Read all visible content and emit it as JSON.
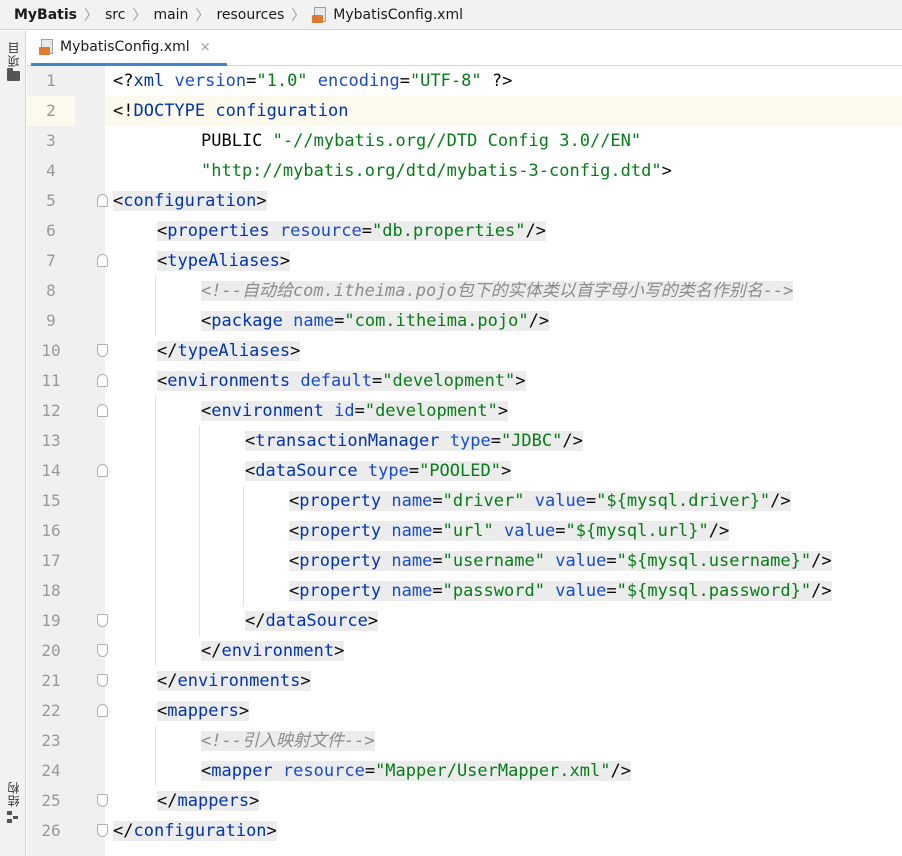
{
  "breadcrumb": {
    "project": "MyBatis",
    "items": [
      "src",
      "main",
      "resources",
      "MybatisConfig.xml"
    ]
  },
  "toolwindows": {
    "project_label": "项目",
    "structure_label": "结构"
  },
  "tab": {
    "label": "MybatisConfig.xml",
    "close": "×"
  },
  "editor": {
    "current_line": 2,
    "line_numbers": [
      "1",
      "2",
      "3",
      "4",
      "5",
      "6",
      "7",
      "8",
      "9",
      "10",
      "11",
      "12",
      "13",
      "14",
      "15",
      "16",
      "17",
      "18",
      "19",
      "20",
      "21",
      "22",
      "23",
      "24",
      "25",
      "26"
    ],
    "lines": [
      "<?xml version=\"1.0\" encoding=\"UTF-8\" ?>",
      "<!DOCTYPE configuration",
      "        PUBLIC \"-//mybatis.org//DTD Config 3.0//EN\"",
      "        \"http://mybatis.org/dtd/mybatis-3-config.dtd\">",
      "<configuration>",
      "    <properties resource=\"db.properties\"/>",
      "    <typeAliases>",
      "        <!--自动给com.itheima.pojo包下的实体类以首字母小写的类名作别名-->",
      "        <package name=\"com.itheima.pojo\"/>",
      "    </typeAliases>",
      "    <environments default=\"development\">",
      "        <environment id=\"development\">",
      "            <transactionManager type=\"JDBC\"/>",
      "            <dataSource type=\"POOLED\">",
      "                <property name=\"driver\" value=\"${mysql.driver}\"/>",
      "                <property name=\"url\" value=\"${mysql.url}\"/>",
      "                <property name=\"username\" value=\"${mysql.username}\"/>",
      "                <property name=\"password\" value=\"${mysql.password}\"/>",
      "            </dataSource>",
      "        </environment>",
      "    </environments>",
      "    <mappers>",
      "        <!--引入映射文件-->",
      "        <mapper resource=\"Mapper/UserMapper.xml\"/>",
      "    </mappers>",
      "</configuration>"
    ]
  },
  "colors": {
    "tag": "#0033b3",
    "attribute": "#174ad4",
    "value": "#067d17",
    "comment": "#8c8c8c",
    "current_line": "#fcfaed",
    "tab_underline": "#4083c9"
  }
}
